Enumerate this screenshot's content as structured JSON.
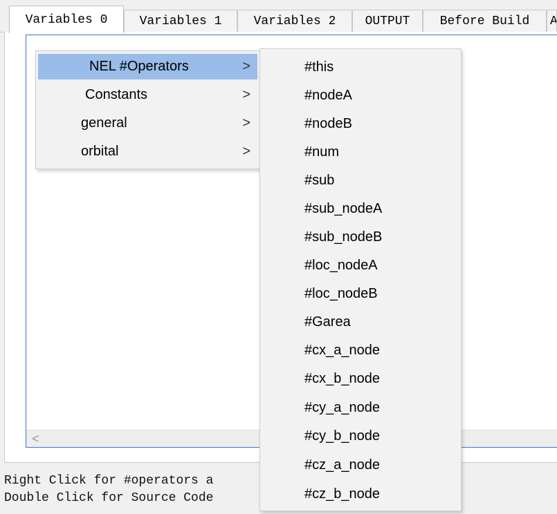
{
  "tabs": [
    {
      "label": "Variables 0",
      "active": true
    },
    {
      "label": "Variables 1",
      "active": false
    },
    {
      "label": "Variables 2",
      "active": false
    },
    {
      "label": "OUTPUT",
      "active": false
    },
    {
      "label": "Before Build",
      "active": false
    },
    {
      "label": "A",
      "active": false
    }
  ],
  "scrollbar": {
    "left_arrow": "<"
  },
  "status": {
    "line1": "Right Click for #operators a",
    "line2": "Double Click for Source Code"
  },
  "context_menu": {
    "items": [
      {
        "label": "NEL #Operators",
        "arrow": ">",
        "highlighted": true
      },
      {
        "label": "Constants",
        "arrow": ">",
        "highlighted": false
      },
      {
        "label": "general",
        "arrow": ">",
        "highlighted": false
      },
      {
        "label": "orbital",
        "arrow": ">",
        "highlighted": false
      }
    ]
  },
  "submenu": {
    "items": [
      "#this",
      "#nodeA",
      "#nodeB",
      "#num",
      "#sub",
      "#sub_nodeA",
      "#sub_nodeB",
      "#loc_nodeA",
      "#loc_nodeB",
      "#Garea",
      "#cx_a_node",
      "#cx_b_node",
      "#cy_a_node",
      "#cy_b_node",
      "#cz_a_node",
      "#cz_b_node"
    ]
  },
  "colors": {
    "highlight": "#99bce8",
    "accent_border": "#3a74c8"
  }
}
